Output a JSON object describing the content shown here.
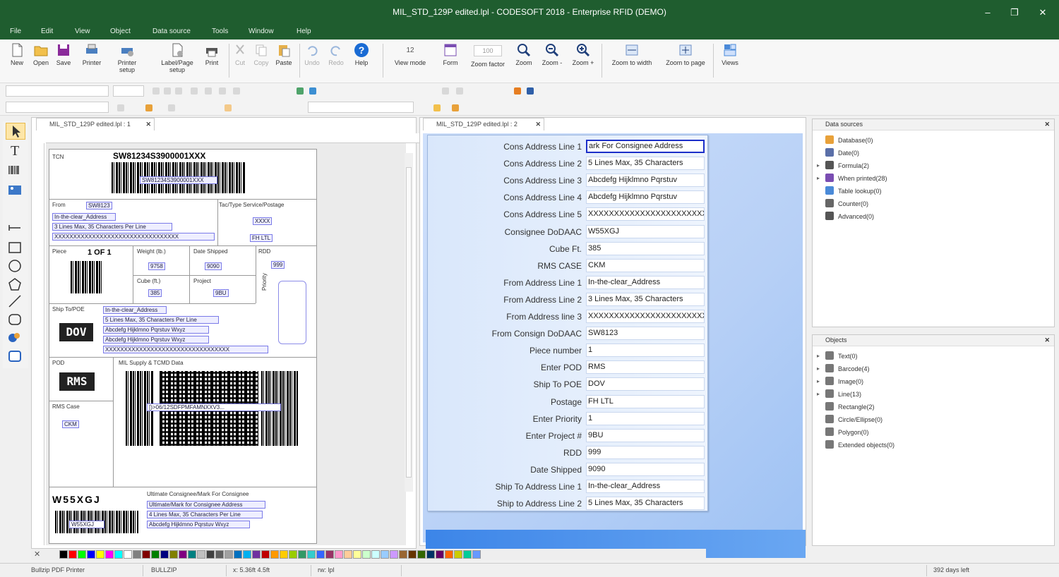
{
  "window": {
    "title": "MIL_STD_129P edited.lpl - CODESOFT 2018 - Enterprise RFID (DEMO)",
    "controls": [
      "–",
      "❐",
      "✕"
    ]
  },
  "menu": [
    "File",
    "Edit",
    "View",
    "Object",
    "Data source",
    "Tools",
    "Window",
    "Help"
  ],
  "toolbar": [
    {
      "label": "New",
      "icon": "new-icon"
    },
    {
      "label": "Open",
      "icon": "open-icon"
    },
    {
      "label": "Save",
      "icon": "save-icon"
    },
    {
      "label": "Printer",
      "icon": "printer-icon"
    },
    {
      "label": "Printer setup",
      "icon": "printer-setup-icon"
    },
    {
      "label": "Label/Page setup",
      "icon": "page-setup-icon"
    },
    {
      "label": "Print",
      "icon": "print-icon"
    },
    {
      "label": "Cut",
      "icon": "cut-icon",
      "disabled": true
    },
    {
      "label": "Copy",
      "icon": "copy-icon",
      "disabled": true
    },
    {
      "label": "Paste",
      "icon": "paste-icon"
    },
    {
      "label": "Undo",
      "icon": "undo-icon",
      "disabled": true
    },
    {
      "label": "Redo",
      "icon": "redo-icon",
      "disabled": true
    },
    {
      "label": "Help",
      "icon": "help-icon"
    },
    {
      "label": "View mode",
      "icon": "view-mode-icon"
    },
    {
      "label": "Form",
      "icon": "form-icon"
    },
    {
      "label": "Zoom factor",
      "icon": "zoom-factor-icon"
    },
    {
      "label": "Zoom",
      "icon": "zoom-icon"
    },
    {
      "label": "Zoom -",
      "icon": "zoom-out-icon"
    },
    {
      "label": "Zoom +",
      "icon": "zoom-in-icon"
    },
    {
      "label": "Zoom to width",
      "icon": "zoom-width-icon"
    },
    {
      "label": "Zoom to page",
      "icon": "zoom-page-icon"
    },
    {
      "label": "Views",
      "icon": "views-icon"
    }
  ],
  "zoom_value": "100",
  "doc1": {
    "tab": "MIL_STD_129P edited.lpl : 1",
    "label": {
      "tcn_label": "TCN",
      "tcn_value": "SW81234S3900001XXX",
      "barcode_text": "SW81234S3900001XXX",
      "from_label": "From",
      "from_code": "SW8123",
      "from_fields": [
        "In-the-clear_Address",
        "3 Lines Max, 35 Characters Per Line",
        "XXXXXXXXXXXXXXXXXXXXXXXXXXXXXXXXX"
      ],
      "tac_label": "Tac/Type Service/Postage",
      "tac_value": "XXXX",
      "fh_value": "FH LTL",
      "piece_label": "Piece",
      "piece_value": "1 OF 1",
      "weight_label": "Weight (lb.)",
      "weight_value": "9758",
      "date_label": "Date Shipped",
      "date_value": "9090",
      "rdd_label": "RDD",
      "rdd_value": "999",
      "cube_label": "Cube (ft.)",
      "cube_value": "385",
      "project_label": "Project",
      "project_value": "9BU",
      "priority_label": "Priority",
      "shipto_label": "Ship To/POE",
      "shipto_code": "DOV",
      "shipto_fields": [
        "In-the-clear_Address",
        "5 Lines Max, 35 Characters Per Line",
        "Abcdefg Hijklmno Pqrstuv Wxyz",
        "Abcdefg Hijklmno Pqrstuv Wxyz",
        "XXXXXXXXXXXXXXXXXXXXXXXXXXXXXXXXX"
      ],
      "pod_label": "POD",
      "pod_code": "RMS",
      "supply_label": "MIL Supply & TCMD Data",
      "pdf_text": "[)>06/12SDFPMFAMNXXV3...",
      "rms_case_label": "RMS Case",
      "rms_case_value": "CKM",
      "consignee_code": "W55XGJ",
      "ultimate_label": "Ultimate Consignee/Mark For Consignee",
      "ultimate_fields": [
        "Ultimate/Mark for Consignee Address",
        "4 Lines Max, 35 Characters Per Line",
        "Abcdefg Hijklmno Pqrstuv Wxyz"
      ],
      "bottom_barcode_text": "W55XGJ"
    }
  },
  "doc2": {
    "tab": "MIL_STD_129P edited.lpl : 2",
    "form_rows": [
      {
        "label": "Cons Address Line 1",
        "value": "ark For Consignee Address",
        "focused": true
      },
      {
        "label": "Cons Address Line 2",
        "value": "5 Lines Max, 35 Characters"
      },
      {
        "label": "Cons Address Line 3",
        "value": "Abcdefg Hijklmno Pqrstuv"
      },
      {
        "label": "Cons Address Line 4",
        "value": "Abcdefg Hijklmno Pqrstuv"
      },
      {
        "label": "Cons Address Line 5",
        "value": "XXXXXXXXXXXXXXXXXXXXXXXX"
      },
      {
        "label": "Consignee DoDAAC",
        "value": "W55XGJ"
      },
      {
        "label": "Cube Ft.",
        "value": "385"
      },
      {
        "label": "RMS CASE",
        "value": "CKM"
      },
      {
        "label": "From Address Line 1",
        "value": "In-the-clear_Address"
      },
      {
        "label": "From Address Line 2",
        "value": "3 Lines Max, 35 Characters"
      },
      {
        "label": "From Address line 3",
        "value": "XXXXXXXXXXXXXXXXXXXXXXXX"
      },
      {
        "label": "From Consign DoDAAC",
        "value": "SW8123"
      },
      {
        "label": "Piece number",
        "value": "1"
      },
      {
        "label": "Enter POD",
        "value": "RMS"
      },
      {
        "label": "Ship To POE",
        "value": "DOV"
      },
      {
        "label": "Postage",
        "value": "FH LTL"
      },
      {
        "label": "Enter Priority",
        "value": "1"
      },
      {
        "label": "Enter Project #",
        "value": "9BU"
      },
      {
        "label": "RDD",
        "value": "999"
      },
      {
        "label": "Date Shipped",
        "value": "9090"
      },
      {
        "label": "Ship To Address Line 1",
        "value": "In-the-clear_Address"
      },
      {
        "label": "Ship to Address Line 2",
        "value": "5 Lines Max, 35 Characters"
      }
    ]
  },
  "data_sources": {
    "title": "Data sources",
    "items": [
      {
        "label": "Database(0)",
        "icon": "database-icon",
        "color": "#e8a13a"
      },
      {
        "label": "Date(0)",
        "icon": "calendar-icon",
        "color": "#5a6fa8"
      },
      {
        "label": "Formula(2)",
        "icon": "formula-icon",
        "color": "#555"
      },
      {
        "label": "When printed(28)",
        "icon": "when-printed-icon",
        "color": "#7a4db2"
      },
      {
        "label": "Table lookup(0)",
        "icon": "table-lookup-icon",
        "color": "#4a8ad8"
      },
      {
        "label": "Counter(0)",
        "icon": "counter-icon",
        "color": "#666"
      },
      {
        "label": "Advanced(0)",
        "icon": "advanced-icon",
        "color": "#555"
      }
    ]
  },
  "objects": {
    "title": "Objects",
    "items": [
      {
        "label": "Text(0)",
        "icon": "text-icon"
      },
      {
        "label": "Barcode(4)",
        "icon": "barcode-icon"
      },
      {
        "label": "Image(0)",
        "icon": "image-icon"
      },
      {
        "label": "Line(13)",
        "icon": "line-icon"
      },
      {
        "label": "Rectangle(2)",
        "icon": "rectangle-icon"
      },
      {
        "label": "Circle/Ellipse(0)",
        "icon": "circle-icon"
      },
      {
        "label": "Polygon(0)",
        "icon": "polygon-icon"
      },
      {
        "label": "Extended objects(0)",
        "icon": "extended-objects-icon"
      }
    ]
  },
  "palette_colors": [
    "#000000",
    "#ff0000",
    "#00ff00",
    "#0000ff",
    "#ffff00",
    "#ff00ff",
    "#00ffff",
    "#ffffff",
    "#808080",
    "#800000",
    "#008000",
    "#000080",
    "#808000",
    "#800080",
    "#008080",
    "#c0c0c0",
    "#404040",
    "#606060",
    "#a0a0a0",
    "#0070c0",
    "#00b0f0",
    "#7030a0",
    "#c00000",
    "#ff9900",
    "#ffcc00",
    "#99cc00",
    "#339966",
    "#33cccc",
    "#3366ff",
    "#993366",
    "#ff99cc",
    "#ffcc99",
    "#ffff99",
    "#ccffcc",
    "#ccffff",
    "#99ccff",
    "#cc99ff",
    "#996633",
    "#663300",
    "#336600",
    "#003366",
    "#660066",
    "#ff6600",
    "#cccc00",
    "#00cc99",
    "#6699ff"
  ],
  "status": {
    "printer": "Bullzip PDF Printer",
    "file": "BULLZIP",
    "coords": "x: 5.36ft  4.5ft",
    "extra": "rw: lpl",
    "days_left": "392 days left"
  }
}
